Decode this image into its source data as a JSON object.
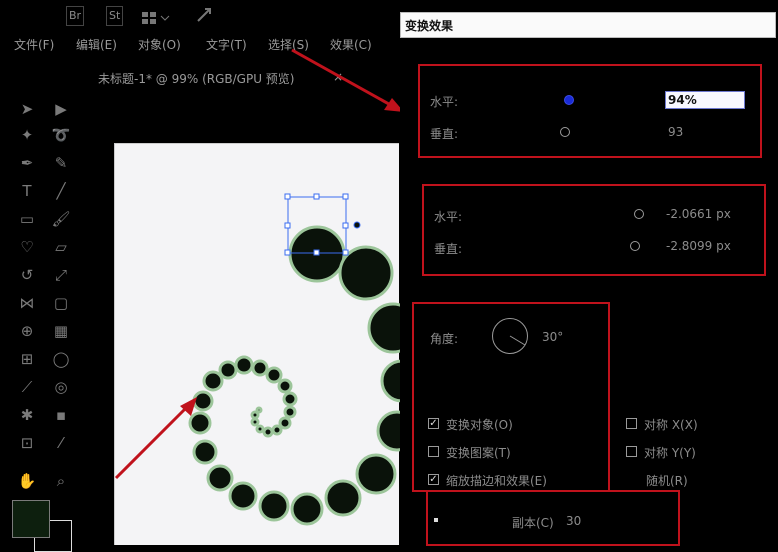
{
  "app": {
    "top_icons": [
      "Br",
      "St"
    ],
    "menu": [
      "文件(F)",
      "编辑(E)",
      "对象(O)",
      "文字(T)",
      "选择(S)",
      "效果(C)"
    ],
    "doc_tab": {
      "title": "未标题-1* @ 99% (RGB/GPU 预览)",
      "close": "×"
    }
  },
  "dialog": {
    "title": "变换效果",
    "scale": {
      "label_h": "水平:",
      "label_v": "垂直:",
      "value_h": "94%",
      "value_v": "93"
    },
    "move": {
      "label_h": "水平:",
      "label_v": "垂直:",
      "value_h": "-2.0661 px",
      "value_v": "-2.8099 px"
    },
    "rotate": {
      "label": "角度:",
      "value": "30°"
    },
    "options": {
      "checked_1": "变换对象(O)",
      "checked_2": "变换图案(T)",
      "checked_3": "缩放描边和效果(E)",
      "right_1": "对称 X(X)",
      "right_2": "对称 Y(Y)",
      "right_3": "随机(R)"
    },
    "copies": {
      "label": "副本(C)",
      "value": "30"
    }
  },
  "colors": {
    "accent_red": "#c0121c",
    "selection_blue": "#1a2bd6"
  }
}
